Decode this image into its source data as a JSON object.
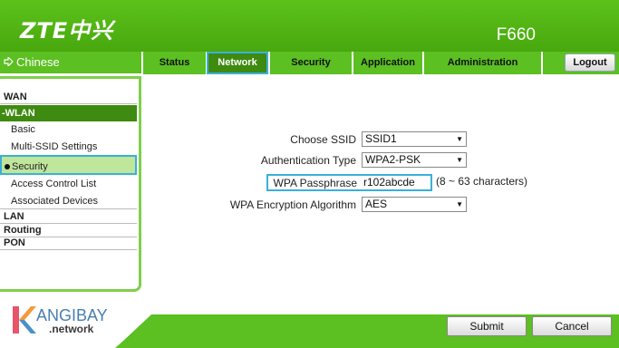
{
  "header": {
    "brand": "ZTE中兴",
    "model": "F660"
  },
  "nav": {
    "language": "Chinese",
    "tabs": [
      {
        "label": "Status"
      },
      {
        "label": "Network"
      },
      {
        "label": "Security"
      },
      {
        "label": "Application"
      },
      {
        "label": "Administration"
      }
    ],
    "active_tab": "Network",
    "logout_label": "Logout"
  },
  "sidebar": {
    "wan": "WAN",
    "wlan": "-WLAN",
    "basic": "Basic",
    "multi_ssid": "Multi-SSID Settings",
    "security": "Security",
    "acl": "Access Control List",
    "associated": "Associated Devices",
    "lan": "LAN",
    "routing": "Routing",
    "pon": "PON"
  },
  "form": {
    "ssid_label": "Choose SSID",
    "ssid_value": "SSID1",
    "auth_label": "Authentication Type",
    "auth_value": "WPA2-PSK",
    "pass_label": "WPA Passphrase",
    "pass_value": "r102abcde",
    "pass_hint": "(8 ~ 63 characters)",
    "enc_label": "WPA Encryption Algorithm",
    "enc_value": "AES"
  },
  "footer": {
    "submit_label": "Submit",
    "cancel_label": "Cancel"
  },
  "watermark": {
    "name": "ANGIBAY",
    "sub": ".network"
  },
  "colors": {
    "brand_green": "#5cbf22",
    "active_green": "#3f8a10",
    "highlight_blue": "#3bb0d8"
  }
}
